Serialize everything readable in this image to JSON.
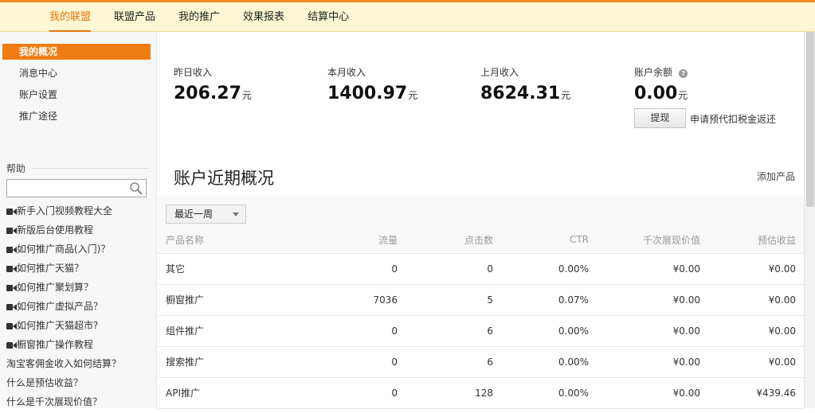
{
  "nav": {
    "items": [
      {
        "label": "我的联盟",
        "active": true
      },
      {
        "label": "联盟产品",
        "active": false
      },
      {
        "label": "我的推广",
        "active": false
      },
      {
        "label": "效果报表",
        "active": false
      },
      {
        "label": "结算中心",
        "active": false
      }
    ]
  },
  "sidebar": {
    "items": [
      {
        "label": "我的概况",
        "active": true
      },
      {
        "label": "消息中心",
        "active": false
      },
      {
        "label": "账户设置",
        "active": false
      },
      {
        "label": "推广途径",
        "active": false
      }
    ],
    "help_title": "帮助",
    "search_value": "",
    "help_links": [
      {
        "label": "新手入门视频教程大全",
        "video": true
      },
      {
        "label": "新版后台使用教程",
        "video": true
      },
      {
        "label": "如何推广商品(入门)？",
        "video": true
      },
      {
        "label": "如何推广天猫？",
        "video": true
      },
      {
        "label": "如何推广聚划算？",
        "video": true
      },
      {
        "label": "如何推广虚拟产品？",
        "video": true
      },
      {
        "label": "如何推广天猫超市?",
        "video": true
      },
      {
        "label": "橱窗推广操作教程",
        "video": true
      },
      {
        "label": "淘宝客佣金收入如何结算？",
        "video": false
      },
      {
        "label": "什么是预估收益？",
        "video": false
      },
      {
        "label": "什么是千次展现价值？",
        "video": false
      }
    ]
  },
  "stats": {
    "yesterday": {
      "label": "昨日收入",
      "value": "206.27",
      "unit": "元"
    },
    "this_month": {
      "label": "本月收入",
      "value": "1400.97",
      "unit": "元"
    },
    "last_month": {
      "label": "上月收入",
      "value": "8624.31",
      "unit": "元"
    },
    "balance": {
      "label": "账户余额",
      "value": "0.00",
      "unit": "元",
      "help": "?"
    }
  },
  "withdraw": {
    "button": "提现",
    "note": "申请预代扣税金返还"
  },
  "overview": {
    "title": "账户近期概况",
    "add_product": "添加产品",
    "period": "最近一周",
    "columns": [
      "产品名称",
      "流量",
      "点击数",
      "CTR",
      "千次展现价值",
      "预估收益"
    ],
    "rows": [
      [
        "其它",
        "0",
        "0",
        "0.00%",
        "¥0.00",
        "¥0.00"
      ],
      [
        "橱窗推广",
        "7036",
        "5",
        "0.07%",
        "¥0.00",
        "¥0.00"
      ],
      [
        "组件推广",
        "0",
        "6",
        "0.00%",
        "¥0.00",
        "¥0.00"
      ],
      [
        "搜索推广",
        "0",
        "6",
        "0.00%",
        "¥0.00",
        "¥0.00"
      ],
      [
        "API推广",
        "0",
        "128",
        "0.00%",
        "¥0.00",
        "¥439.46"
      ]
    ]
  },
  "colors": {
    "accent": "#f07d14",
    "nav_bg": "#fdf6d3",
    "sidebar_bg": "#f7f7f7"
  }
}
